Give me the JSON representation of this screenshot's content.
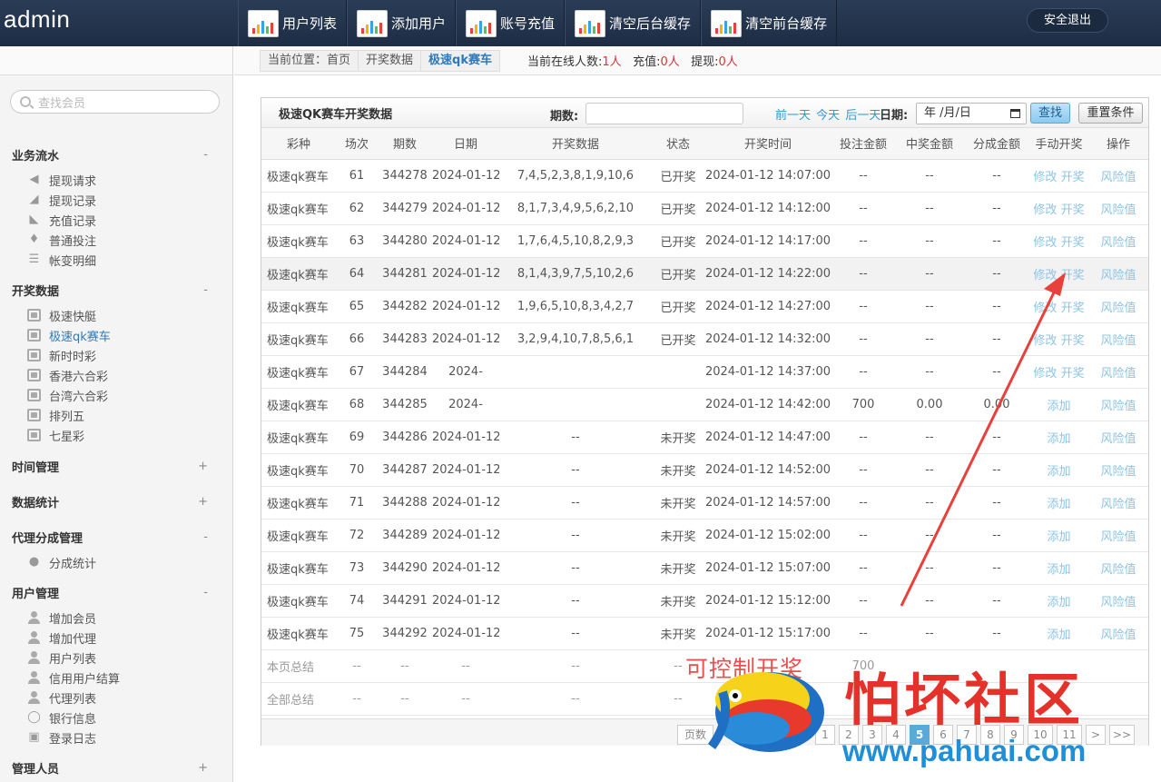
{
  "brand": "admin",
  "topnav": [
    {
      "label": "用户列表",
      "icon": "chart-icon"
    },
    {
      "label": "添加用户",
      "icon": "chart-icon"
    },
    {
      "label": "账号充值",
      "icon": "chart-icon"
    },
    {
      "label": "清空后台缓存",
      "icon": "chart-icon"
    },
    {
      "label": "清空前台缓存",
      "icon": "chart-icon"
    }
  ],
  "logout_label": "安全退出",
  "search_placeholder": "查找会员",
  "sidebar": {
    "groups": [
      {
        "title": "业务流水",
        "toggle": "-",
        "items": [
          "提现请求",
          "提现记录",
          "充值记录",
          "普通投注",
          "帐变明细"
        ]
      },
      {
        "title": "开奖数据",
        "toggle": "-",
        "items": [
          "极速快艇",
          "极速qk赛车",
          "新时时彩",
          "香港六合彩",
          "台湾六合彩",
          "排列五",
          "七星彩"
        ]
      },
      {
        "title": "时间管理",
        "toggle": "+",
        "items": []
      },
      {
        "title": "数据统计",
        "toggle": "+",
        "items": []
      },
      {
        "title": "代理分成管理",
        "toggle": "-",
        "items": [
          "分成统计"
        ]
      },
      {
        "title": "用户管理",
        "toggle": "-",
        "items": [
          "增加会员",
          "增加代理",
          "用户列表",
          "信用用户结算",
          "代理列表",
          "银行信息",
          "登录日志"
        ]
      },
      {
        "title": "管理人员",
        "toggle": "+",
        "items": []
      }
    ],
    "active_item": "极速qk赛车"
  },
  "breadcrumb": {
    "items": [
      "当前位置：首页",
      "开奖数据",
      "极速qk赛车"
    ],
    "online_label": "当前在线人数:",
    "online_count": "1人",
    "recharge_label": "充值:",
    "recharge_count": "0人",
    "withdraw_label": "提现:",
    "withdraw_count": "0人"
  },
  "panel": {
    "title": "极速QK赛车开奖数据",
    "issue_label": "期数:",
    "issue_value": "",
    "prev_day": "前一天",
    "today": "今天",
    "next_day": "后一天",
    "date_label": "日期:",
    "date_value": "年 /月/日",
    "find_button": "查找",
    "reset_button": "重置条件"
  },
  "table": {
    "columns": [
      "彩种",
      "场次",
      "期数",
      "日期",
      "开奖数据",
      "状态",
      "开奖时间",
      "投注金额",
      "中奖金额",
      "分成金额",
      "手动开奖",
      "操作"
    ],
    "rows": [
      [
        "极速qk赛车",
        "61",
        "344278",
        "2024-01-12",
        "7,4,5,2,3,8,1,9,10,6",
        "已开奖",
        "2024-01-12 14:07:00",
        "--",
        "--",
        "--",
        "修改 开奖",
        "风险值"
      ],
      [
        "极速qk赛车",
        "62",
        "344279",
        "2024-01-12",
        "8,1,7,3,4,9,5,6,2,10",
        "已开奖",
        "2024-01-12 14:12:00",
        "--",
        "--",
        "--",
        "修改 开奖",
        "风险值"
      ],
      [
        "极速qk赛车",
        "63",
        "344280",
        "2024-01-12",
        "1,7,6,4,5,10,8,2,9,3",
        "已开奖",
        "2024-01-12 14:17:00",
        "--",
        "--",
        "--",
        "修改 开奖",
        "风险值"
      ],
      [
        "极速qk赛车",
        "64",
        "344281",
        "2024-01-12",
        "8,1,4,3,9,7,5,10,2,6",
        "已开奖",
        "2024-01-12 14:22:00",
        "--",
        "--",
        "--",
        "修改 开奖",
        "风险值"
      ],
      [
        "极速qk赛车",
        "65",
        "344282",
        "2024-01-12",
        "1,9,6,5,10,8,3,4,2,7",
        "已开奖",
        "2024-01-12 14:27:00",
        "--",
        "--",
        "--",
        "修改 开奖",
        "风险值"
      ],
      [
        "极速qk赛车",
        "66",
        "344283",
        "2024-01-12",
        "3,2,9,4,10,7,8,5,6,1",
        "已开奖",
        "2024-01-12 14:32:00",
        "--",
        "--",
        "--",
        "修改 开奖",
        "风险值"
      ],
      [
        "极速qk赛车",
        "67",
        "344284",
        "2024-",
        "",
        "",
        "2024-01-12 14:37:00",
        "--",
        "--",
        "--",
        "修改 开奖",
        "风险值"
      ],
      [
        "极速qk赛车",
        "68",
        "344285",
        "2024-",
        "",
        "",
        "2024-01-12 14:42:00",
        "700",
        "0.00",
        "0.00",
        "添加",
        "风险值"
      ],
      [
        "极速qk赛车",
        "69",
        "344286",
        "2024-01-12",
        "--",
        "未开奖",
        "2024-01-12 14:47:00",
        "--",
        "--",
        "--",
        "添加",
        "风险值"
      ],
      [
        "极速qk赛车",
        "70",
        "344287",
        "2024-01-12",
        "--",
        "未开奖",
        "2024-01-12 14:52:00",
        "--",
        "--",
        "--",
        "添加",
        "风险值"
      ],
      [
        "极速qk赛车",
        "71",
        "344288",
        "2024-01-12",
        "--",
        "未开奖",
        "2024-01-12 14:57:00",
        "--",
        "--",
        "--",
        "添加",
        "风险值"
      ],
      [
        "极速qk赛车",
        "72",
        "344289",
        "2024-01-12",
        "--",
        "未开奖",
        "2024-01-12 15:02:00",
        "--",
        "--",
        "--",
        "添加",
        "风险值"
      ],
      [
        "极速qk赛车",
        "73",
        "344290",
        "2024-01-12",
        "--",
        "未开奖",
        "2024-01-12 15:07:00",
        "--",
        "--",
        "--",
        "添加",
        "风险值"
      ],
      [
        "极速qk赛车",
        "74",
        "344291",
        "2024-01-12",
        "--",
        "未开奖",
        "2024-01-12 15:12:00",
        "--",
        "--",
        "--",
        "添加",
        "风险值"
      ],
      [
        "极速qk赛车",
        "75",
        "344292",
        "2024-01-12",
        "--",
        "未开奖",
        "2024-01-12 15:17:00",
        "--",
        "--",
        "--",
        "添加",
        "风险值"
      ]
    ],
    "summary_rows": [
      [
        "本页总结",
        "--",
        "--",
        "--",
        "--",
        "--",
        "",
        "700",
        "",
        "",
        "",
        ""
      ],
      [
        "全部总结",
        "--",
        "--",
        "--",
        "--",
        "--",
        "",
        "",
        "",
        "",
        "",
        ""
      ]
    ],
    "highlighted_row": 3
  },
  "pager": {
    "label": "页数",
    "pages": [
      "1",
      "2",
      "3",
      "4",
      "5",
      "6",
      "7",
      "8",
      "9",
      "10",
      "11",
      ">",
      ">>"
    ],
    "current": "5"
  },
  "watermark": {
    "annotation": "可控制开奖",
    "brand": "怕坏社区",
    "url": "www.pahuai.com"
  },
  "colors": {
    "topbar": "#22344d",
    "link": "#2e9bd0",
    "alert_red": "#d33",
    "arrow_red": "#e8403a"
  }
}
